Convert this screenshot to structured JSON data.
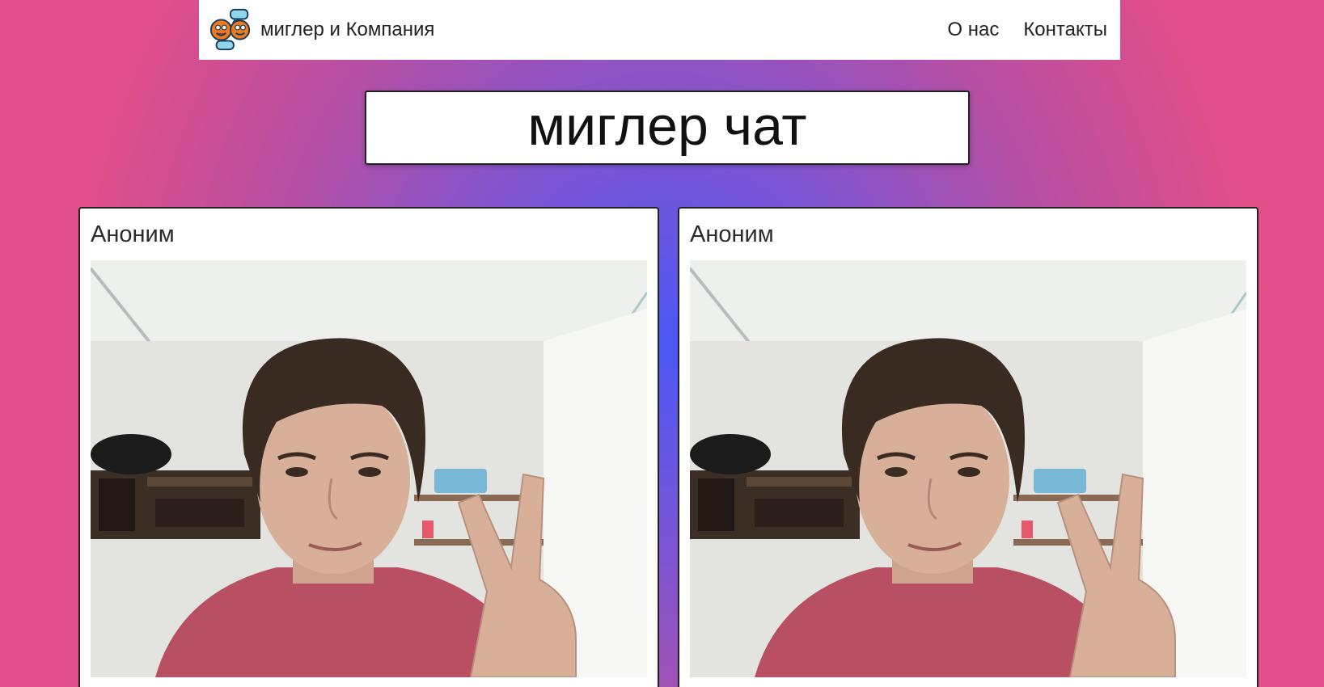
{
  "navbar": {
    "brand_name": "миглер и Компания",
    "links": [
      "О нас",
      "Контакты"
    ]
  },
  "main": {
    "title": "миглер чат"
  },
  "videos": [
    {
      "name": "Аноним"
    },
    {
      "name": "Аноним"
    }
  ],
  "colors": {
    "bg_center": "#4a57f5",
    "bg_edge": "#e24f88",
    "card_border": "#222222"
  },
  "icons": {
    "logo": "chat-faces-logo"
  }
}
